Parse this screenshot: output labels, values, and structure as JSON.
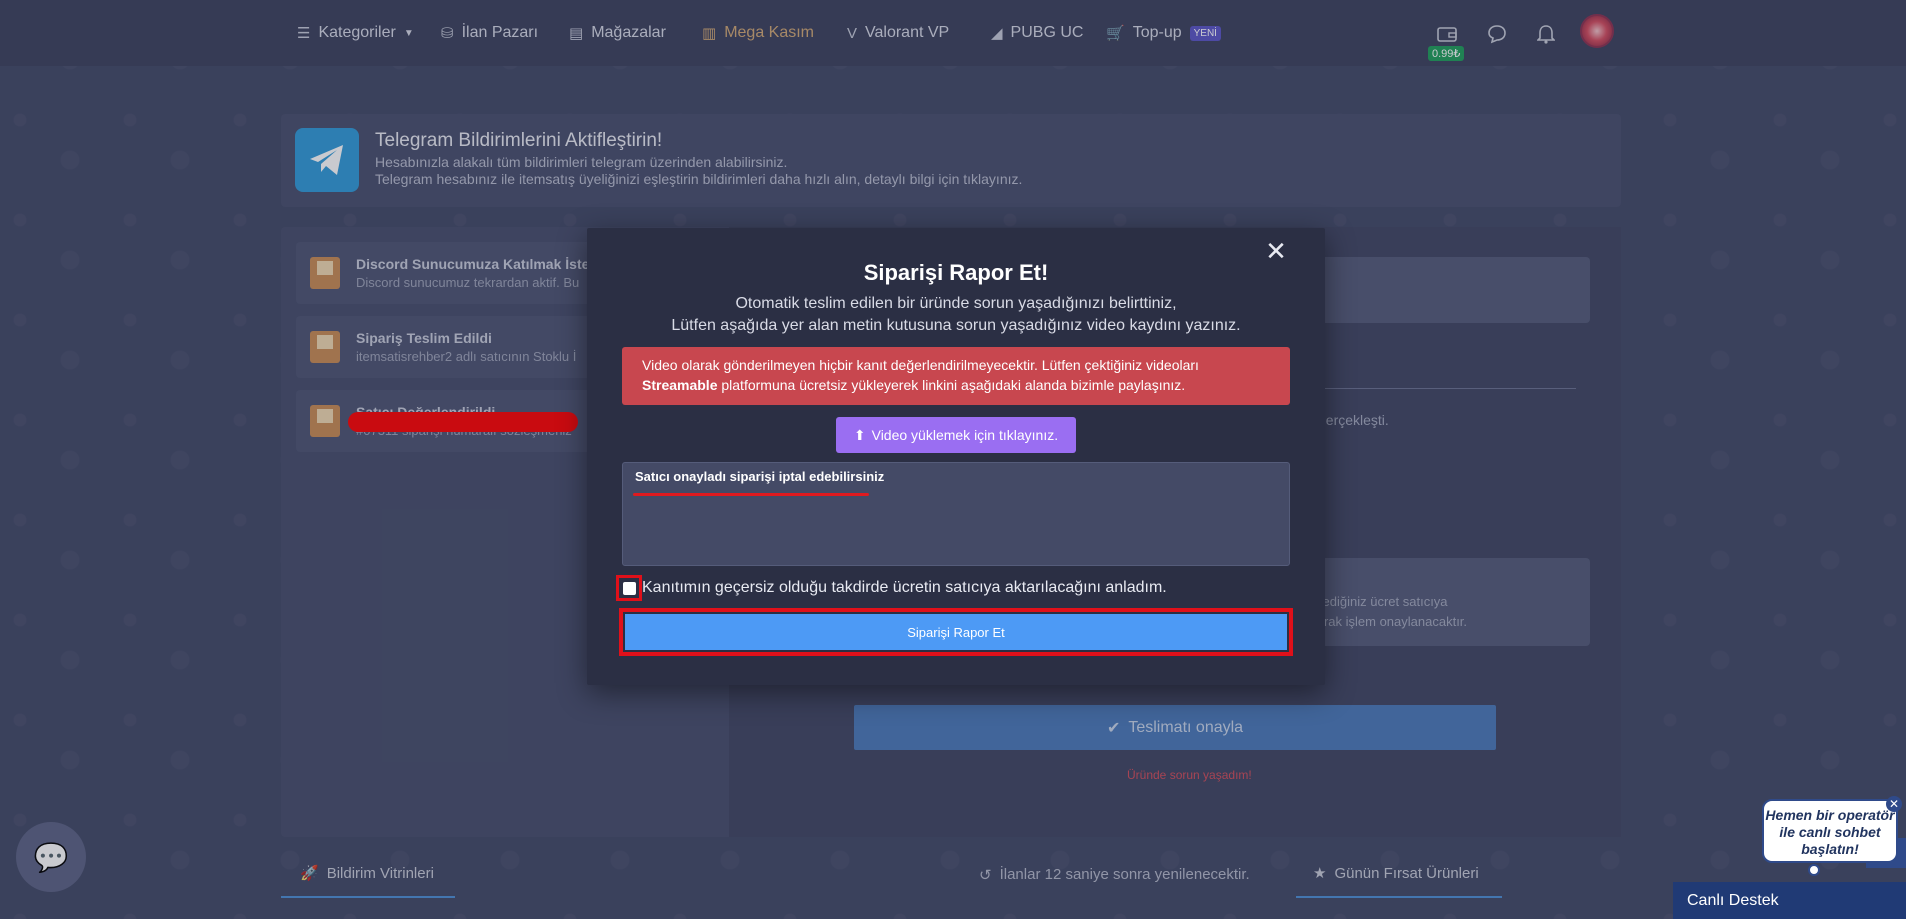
{
  "nav": {
    "items": [
      {
        "label": "Kategoriler",
        "icon": "list-icon"
      },
      {
        "label": "İlan Pazarı",
        "icon": "basket-icon"
      },
      {
        "label": "Mağazalar",
        "icon": "store-icon"
      },
      {
        "label": "Mega Kasım",
        "icon": "books-icon"
      },
      {
        "label": "Valorant VP",
        "icon": "valorant-icon"
      },
      {
        "label": "PUBG UC",
        "icon": "pubg-icon"
      },
      {
        "label": "Top-up",
        "icon": "cart-icon"
      }
    ],
    "new_badge": "YENİ",
    "balance": "0.99₺"
  },
  "telegram_banner": {
    "title": "Telegram Bildirimlerini Aktifleştirin!",
    "line1": "Hesabınızla alakalı tüm bildirimleri telegram üzerinden alabilirsiniz.",
    "line2": "Telegram hesabınız ile itemsatış üyeliğinizi eşleştirin bildirimleri daha hızlı alın, detaylı bilgi için tıklayınız."
  },
  "notifications": [
    {
      "title": "Discord Sunucumuza Katılmak İste",
      "sub": "Discord sunucumuz tekrardan aktif. Bu"
    },
    {
      "title": "Sipariş Teslim Edildi",
      "sub": "itemsatisrehber2 adlı satıcının Stoklu İ"
    },
    {
      "title": "Satıcı Değerlendirildi",
      "sub": "#07311 siparişi numaralı sözleşmeniz"
    }
  ],
  "order_panel": {
    "status_text": "gerçekleşti.",
    "info_line1": "da ödediğiniz ücret satıcıya",
    "info_line2": "tik olarak işlem onaylanacaktır.",
    "confirm_button": "Teslimatı onayla",
    "problem_link": "Üründe sorun yaşadım!"
  },
  "bottom": {
    "tab1": "Bildirim Vitrinleri",
    "refresh_note": "İlanlar 12 saniye sonra yenilenecektir.",
    "tab2": "Günün Fırsat Ürünleri"
  },
  "support": {
    "bubble": "Hemen bir operatör ile canlı sohbet başlatın!",
    "live_support": "Canlı Destek"
  },
  "modal": {
    "title": "Siparişi Rapor Et!",
    "desc_line1": "Otomatik teslim edilen bir üründe sorun yaşadığınızı belirttiniz,",
    "desc_line2": "Lütfen aşağıda yer alan metin kutusuna sorun yaşadığınız video kaydını yazınız.",
    "warning_part1": "Video olarak gönderilmeyen hiçbir kanıt değerlendirilmeyecektir. Lütfen çektiğiniz videoları ",
    "warning_bold": "Streamable",
    "warning_part2": " platformuna ücretsiz yükleyerek linkini aşağıdaki alanda bizimle paylaşınız.",
    "upload_button": "Video yüklemek için tıklayınız.",
    "textarea_value": "Satıcı onayladı siparişi iptal edebilirsiniz",
    "checkbox_label": "Kanıtımın geçersiz olduğu takdirde ücretin satıcıya aktarılacağını anladım.",
    "submit_button": "Siparişi Rapor Et",
    "checkbox_checked": false
  },
  "colors": {
    "warning": "#c8474f",
    "upload": "#9a6ef2",
    "submit": "#4d9af5",
    "highlight": "#e0101a"
  }
}
